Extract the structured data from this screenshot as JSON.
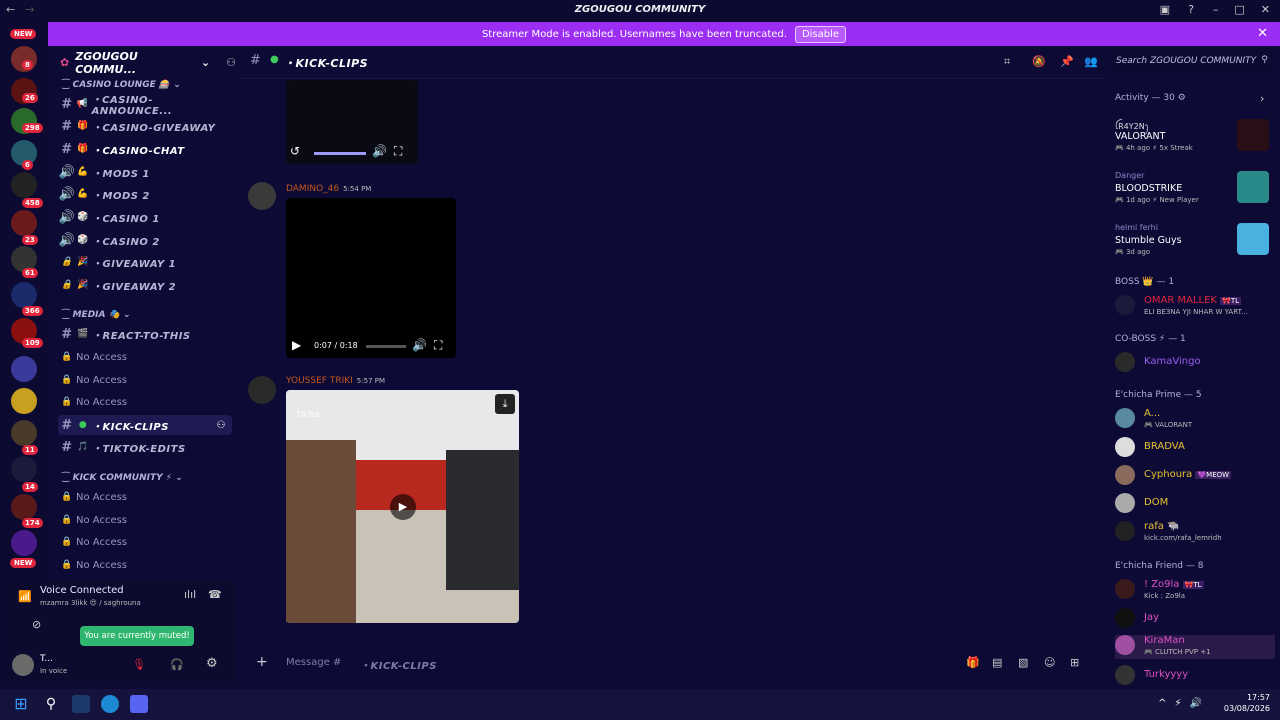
{
  "titlebar": {
    "title": "ZGOUGOU COMMUNITY"
  },
  "banner": {
    "text": "Streamer Mode is enabled. Usernames have been truncated.",
    "disable": "Disable"
  },
  "rail": {
    "badges": [
      "8",
      "26",
      "298",
      "6",
      "458",
      "23",
      "61",
      "366",
      "109",
      "11",
      "14",
      "174"
    ],
    "new_labels": [
      "NEW",
      "NEW"
    ]
  },
  "server": {
    "name": "ZGOUGOU COMMU..."
  },
  "categories": {
    "casino": "CASINO LOUNGE",
    "media": "MEDIA",
    "kick": "KICK COMMUNITY"
  },
  "channels": [
    {
      "label": "・CASINO-ANNOUNCE..."
    },
    {
      "label": "・CASINO-GIVEAWAY"
    },
    {
      "label": "・CASINO-CHAT"
    },
    {
      "label": "・MODS 1"
    },
    {
      "label": "・MODS 2"
    },
    {
      "label": "・CASINO 1"
    },
    {
      "label": "・CASINO 2"
    },
    {
      "label": "・GIVEAWAY 1"
    },
    {
      "label": "・GIVEAWAY 2"
    },
    {
      "label": "・REACT-TO-THIS"
    },
    {
      "label": "No Access"
    },
    {
      "label": "No Access"
    },
    {
      "label": "No Access"
    },
    {
      "label": "・KICK-CLIPS"
    },
    {
      "label": "・TIKTOK-EDITS"
    },
    {
      "label": "No Access"
    },
    {
      "label": "No Access"
    },
    {
      "label": "No Access"
    },
    {
      "label": "No Access"
    }
  ],
  "voice": {
    "status": "Voice Connected",
    "location": "mzamra 3likk 😍 / saghrouna",
    "muted_tip": "You are currently muted!",
    "user": "T...",
    "user_status": "In voice"
  },
  "header": {
    "channel": "・KICK-CLIPS",
    "search_placeholder": "Search ZGOUGOU COMMUNITY"
  },
  "messages": [
    {
      "author": "DAMINO_46",
      "time": "5:54 PM",
      "video_time": "0:07 / 0:18"
    },
    {
      "author": "YOUSSEF TRIKI",
      "time": "5:57 PM",
      "tiktok": "TikTok"
    }
  ],
  "composer": {
    "placeholder": "Message #",
    "channel": "・KICK-CLIPS"
  },
  "members": {
    "activity_header": "Activity — 30",
    "activities": [
      {
        "name": "ꪶR4Y2Nꫂ",
        "game": "VALORANT",
        "meta": "🎮 4h ago  ⚡ 5x Streak"
      },
      {
        "name": "Danger",
        "game": "BLOODSTRIKE",
        "meta": "🎮 1d ago  ⚡ New Player"
      },
      {
        "name": "helmi ferhi",
        "game": "Stumble Guys",
        "meta": "🎮 3d ago"
      }
    ],
    "groups": [
      {
        "header": "BOSS 👑 — 1",
        "members": [
          {
            "name": "OMAR MALLEK",
            "tag": "🎀TL",
            "status": "ELI BE3NA YJI NHAR W YART..."
          }
        ]
      },
      {
        "header": "CO-BOSS ⚡ — 1",
        "members": [
          {
            "name": "KamaVingo",
            "status": ""
          }
        ]
      },
      {
        "header": "E'chicha Prime — 5",
        "members": [
          {
            "name": "A...",
            "status": "🎮 VALORANT"
          },
          {
            "name": "BRADVA",
            "status": ""
          },
          {
            "name": "Cyphoura",
            "tag": "💜MEOW",
            "status": ""
          },
          {
            "name": "DOM",
            "status": ""
          },
          {
            "name": "rafa 🐃",
            "status": "kick.com/rafa_lemridh"
          }
        ]
      },
      {
        "header": "E'chicha Friend — 8",
        "members": [
          {
            "name": "! Zo9la",
            "tag": "🎀TL",
            "status": "Kick : Zo9la"
          },
          {
            "name": "Jay",
            "status": ""
          },
          {
            "name": "KiraMan",
            "status": "🎮 CLUTCH PVP +1"
          },
          {
            "name": "Turkyyyy",
            "status": ""
          }
        ]
      }
    ]
  },
  "taskbar": {
    "time": "17:57",
    "date": "03/08/2026"
  }
}
